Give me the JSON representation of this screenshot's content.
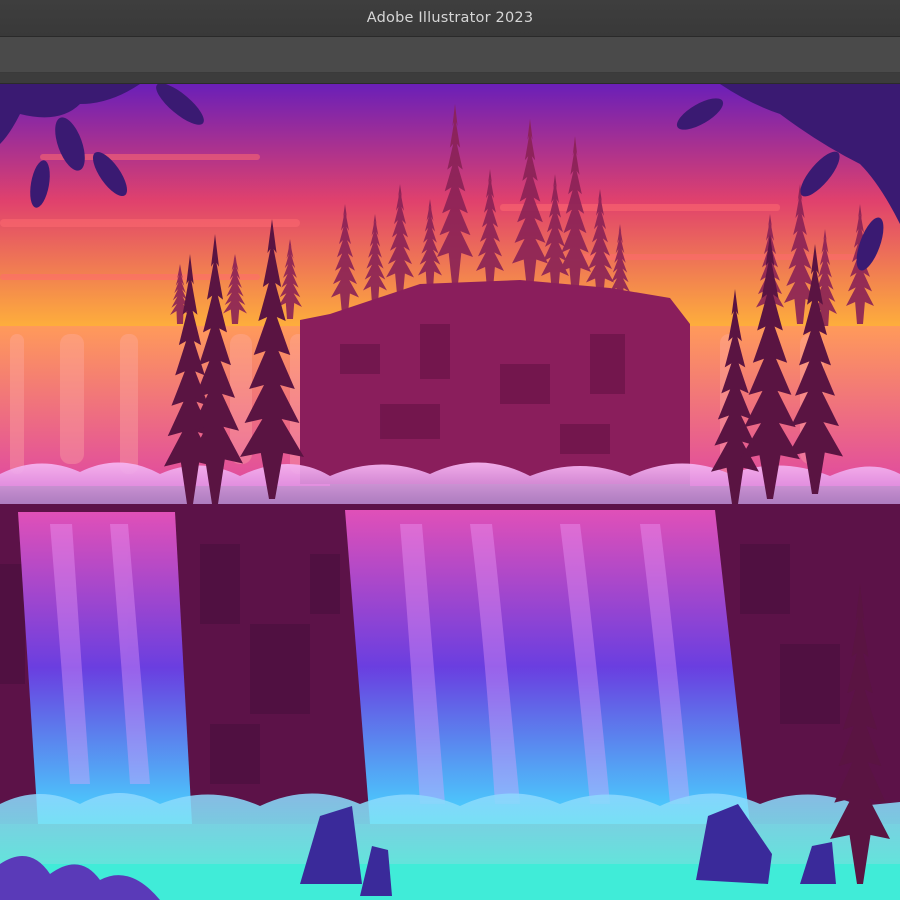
{
  "window": {
    "title": "Adobe Illustrator 2023"
  },
  "artwork": {
    "subject": "waterfall-landscape",
    "colors": {
      "sky_top": "#6a1fb8",
      "sky_mid": "#e0416d",
      "sky_glow": "#ffb23a",
      "cliff": "#8a1e5c",
      "cliff_dark": "#5c1248",
      "water_top": "#e050b8",
      "water_mid": "#6a3ee0",
      "water_bottom": "#48d8ff",
      "mist": "#f0a8ee",
      "pool": "#40ecd8",
      "tree": "#5a1442"
    }
  }
}
